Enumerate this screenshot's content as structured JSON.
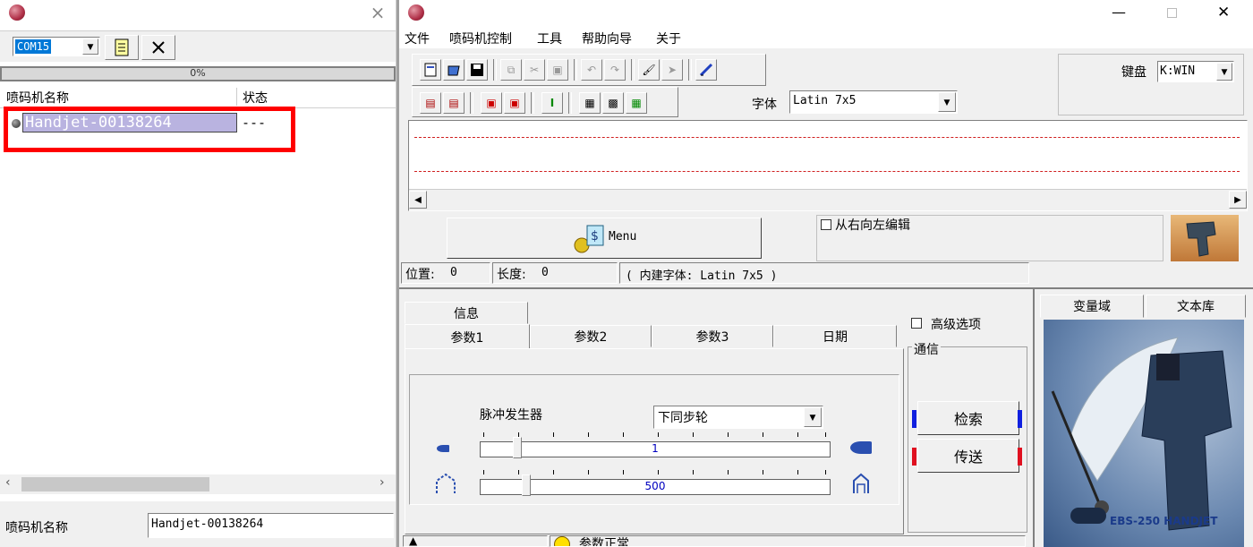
{
  "left": {
    "close_symbol": "×",
    "com_port": "COM15",
    "progress_text": "0%",
    "col_name": "喷码机名称",
    "col_status": "状态",
    "device_name": "Handjet-00138264",
    "device_status": "---",
    "footer_label": "喷码机名称",
    "footer_value": "Handjet-00138264"
  },
  "window": {
    "minimize_symbol": "—",
    "close_symbol": "✕"
  },
  "menu": [
    "文件",
    "喷码机控制",
    "工具",
    "帮助向导",
    "关于"
  ],
  "keyboard": {
    "label": "键盘",
    "value": "K:WIN"
  },
  "font": {
    "label": "字体",
    "value": "Latin 7x5"
  },
  "menu_button": "Menu",
  "rtl_edit": "从右向左编辑",
  "status": {
    "pos_label": "位置:",
    "pos_value": "0",
    "len_label": "长度:",
    "len_value": "0",
    "font_info": "( 内建字体: Latin 7x5 )"
  },
  "tabs": {
    "top": [
      "信息"
    ],
    "bottom": [
      "参数1",
      "参数2",
      "参数3",
      "日期"
    ]
  },
  "advanced": "高级选项",
  "comm": {
    "group": "通信",
    "search": "检索",
    "send": "传送"
  },
  "params": {
    "pulse_label": "脉冲发生器",
    "pulse_value": "下同步轮",
    "slider1_value": "1",
    "slider2_value": "500"
  },
  "right_tabs": [
    "变量域",
    "文本库"
  ],
  "product_caption": "EBS-250 HANDJET",
  "bottom_status": "参数正常",
  "colors": {
    "highlight_red": "#ff0000",
    "selection": "#b9b3e0",
    "slider_text": "#0000c0"
  }
}
